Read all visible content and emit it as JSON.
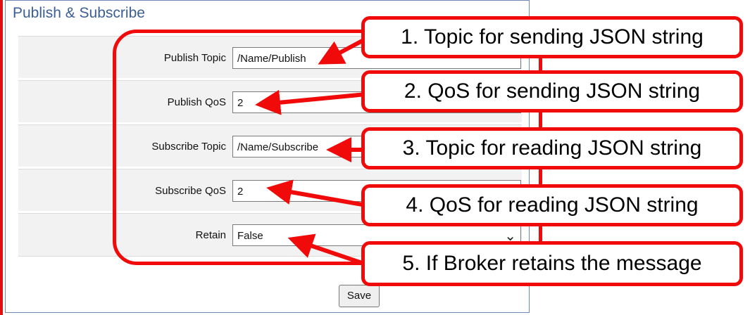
{
  "panel": {
    "title": "Publish & Subscribe"
  },
  "rows": [
    {
      "label": "Publish Topic",
      "value": "/Name/Publish"
    },
    {
      "label": "Publish QoS",
      "value": "2"
    },
    {
      "label": "Subscribe Topic",
      "value": "/Name/Subscribe"
    },
    {
      "label": "Subscribe QoS",
      "value": "2"
    },
    {
      "label": "Retain",
      "value": "False"
    }
  ],
  "save_label": "Save",
  "callouts": [
    "1. Topic for sending JSON string",
    "2. QoS for sending JSON string",
    "3. Topic for reading JSON string",
    "4. QoS for reading JSON string",
    "5. If Broker retains the message"
  ],
  "colors": {
    "annotation": "#f00a0a",
    "title": "#3b5f95",
    "row_bg": "#f2f2f2"
  }
}
